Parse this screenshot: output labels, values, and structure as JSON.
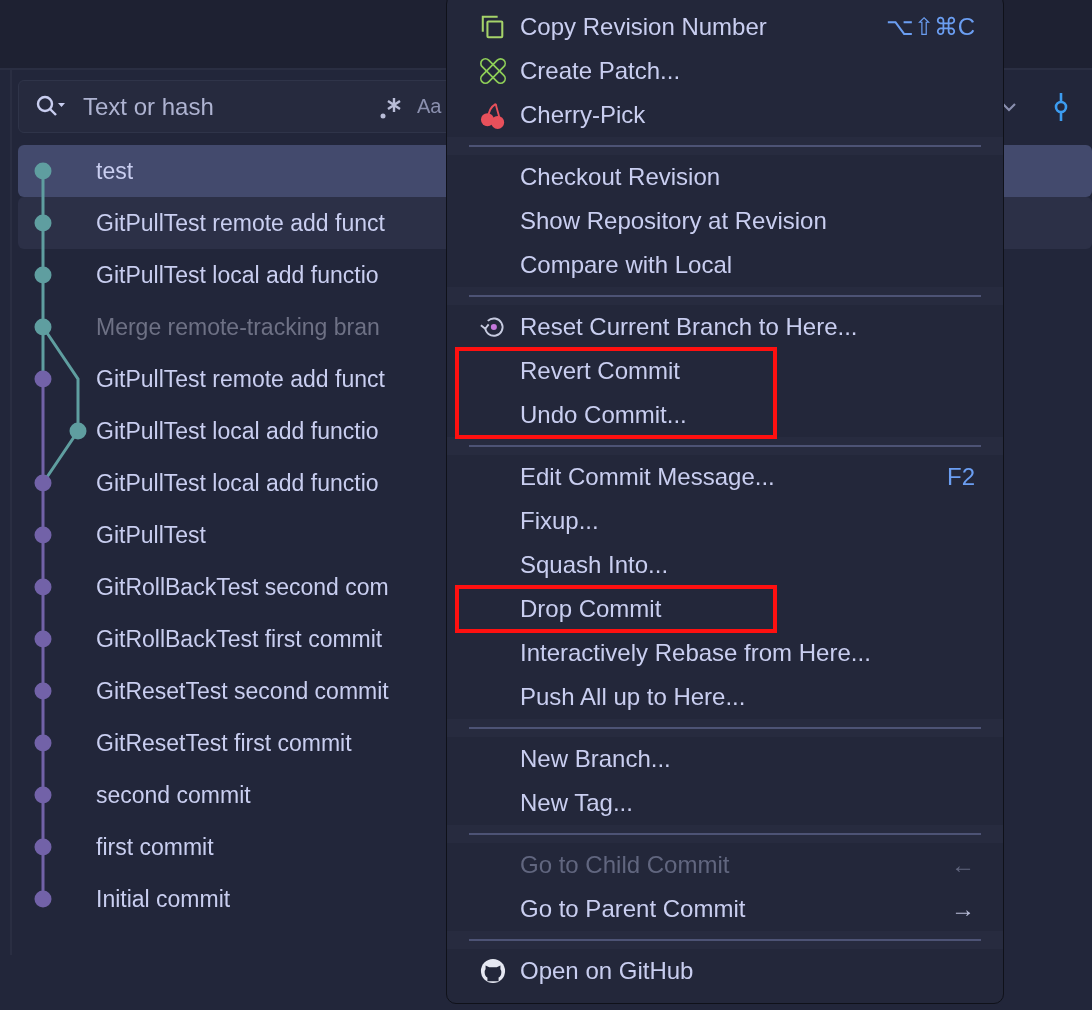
{
  "search": {
    "placeholder": "Text or hash",
    "case_label": "Aa"
  },
  "commits": [
    {
      "message": "test",
      "kind": "commit",
      "color": "#5f9ea0",
      "selected": true,
      "hovered": false
    },
    {
      "message": "GitPullTest remote add funct",
      "kind": "commit",
      "color": "#5f9ea0",
      "selected": false,
      "hovered": true
    },
    {
      "message": "GitPullTest local add functio",
      "kind": "commit",
      "color": "#5f9ea0",
      "selected": false,
      "hovered": false
    },
    {
      "message": "Merge remote-tracking bran",
      "kind": "merge",
      "color": "#5f9ea0",
      "selected": false,
      "hovered": false
    },
    {
      "message": "GitPullTest remote add funct",
      "kind": "commit",
      "color": "#7262a8",
      "selected": false,
      "hovered": false
    },
    {
      "message": "GitPullTest local add functio",
      "kind": "side",
      "color": "#5f9ea0",
      "selected": false,
      "hovered": false
    },
    {
      "message": "GitPullTest local add functio",
      "kind": "commit",
      "color": "#7262a8",
      "selected": false,
      "hovered": false
    },
    {
      "message": "GitPullTest",
      "kind": "commit",
      "color": "#7262a8",
      "selected": false,
      "hovered": false
    },
    {
      "message": "GitRollBackTest second com",
      "kind": "commit",
      "color": "#7262a8",
      "selected": false,
      "hovered": false
    },
    {
      "message": "GitRollBackTest first commit",
      "kind": "commit",
      "color": "#7262a8",
      "selected": false,
      "hovered": false
    },
    {
      "message": "GitResetTest second commit",
      "kind": "commit",
      "color": "#7262a8",
      "selected": false,
      "hovered": false
    },
    {
      "message": "GitResetTest first commit",
      "kind": "commit",
      "color": "#7262a8",
      "selected": false,
      "hovered": false
    },
    {
      "message": "second commit",
      "kind": "commit",
      "color": "#7262a8",
      "selected": false,
      "hovered": false
    },
    {
      "message": "first commit",
      "kind": "commit",
      "color": "#7262a8",
      "selected": false,
      "hovered": false
    },
    {
      "message": "Initial commit",
      "kind": "commit",
      "color": "#7262a8",
      "selected": false,
      "hovered": false
    }
  ],
  "context_menu": {
    "groups": [
      {
        "items": [
          {
            "label": "Copy Revision Number",
            "kind": "copy",
            "shortcut": "⌥⇧⌘C",
            "disabled": false,
            "highlighted": false
          },
          {
            "label": "Create Patch...",
            "kind": "patch",
            "disabled": false,
            "highlighted": false
          },
          {
            "label": "Cherry-Pick",
            "kind": "cherry",
            "disabled": false,
            "highlighted": false
          }
        ]
      },
      {
        "items": [
          {
            "label": "Checkout Revision",
            "disabled": false,
            "highlighted": false
          },
          {
            "label": "Show Repository at Revision",
            "disabled": false,
            "highlighted": false
          },
          {
            "label": "Compare with Local",
            "disabled": false,
            "highlighted": false
          }
        ]
      },
      {
        "items": [
          {
            "label": "Reset Current Branch to Here...",
            "kind": "reset",
            "disabled": false,
            "highlighted": false
          },
          {
            "label": "Revert Commit",
            "disabled": false,
            "highlighted": true
          },
          {
            "label": "Undo Commit...",
            "disabled": false,
            "highlighted": true
          }
        ]
      },
      {
        "items": [
          {
            "label": "Edit Commit Message...",
            "shortcut": "F2",
            "disabled": false,
            "highlighted": false
          },
          {
            "label": "Fixup...",
            "disabled": false,
            "highlighted": false
          },
          {
            "label": "Squash Into...",
            "disabled": false,
            "highlighted": false
          },
          {
            "label": "Drop Commit",
            "disabled": false,
            "highlighted": true
          },
          {
            "label": "Interactively Rebase from Here...",
            "disabled": false,
            "highlighted": false
          },
          {
            "label": "Push All up to Here...",
            "disabled": false,
            "highlighted": false
          }
        ]
      },
      {
        "items": [
          {
            "label": "New Branch...",
            "disabled": false,
            "highlighted": false
          },
          {
            "label": "New Tag...",
            "disabled": false,
            "highlighted": false
          }
        ]
      },
      {
        "items": [
          {
            "label": "Go to Child Commit",
            "kind": "navigate",
            "shortcut": "←",
            "disabled": true,
            "highlighted": false
          },
          {
            "label": "Go to Parent Commit",
            "kind": "navigate",
            "shortcut": "→",
            "disabled": false,
            "highlighted": false
          }
        ]
      },
      {
        "items": [
          {
            "label": "Open on GitHub",
            "kind": "github",
            "disabled": false,
            "highlighted": false
          }
        ]
      }
    ]
  }
}
